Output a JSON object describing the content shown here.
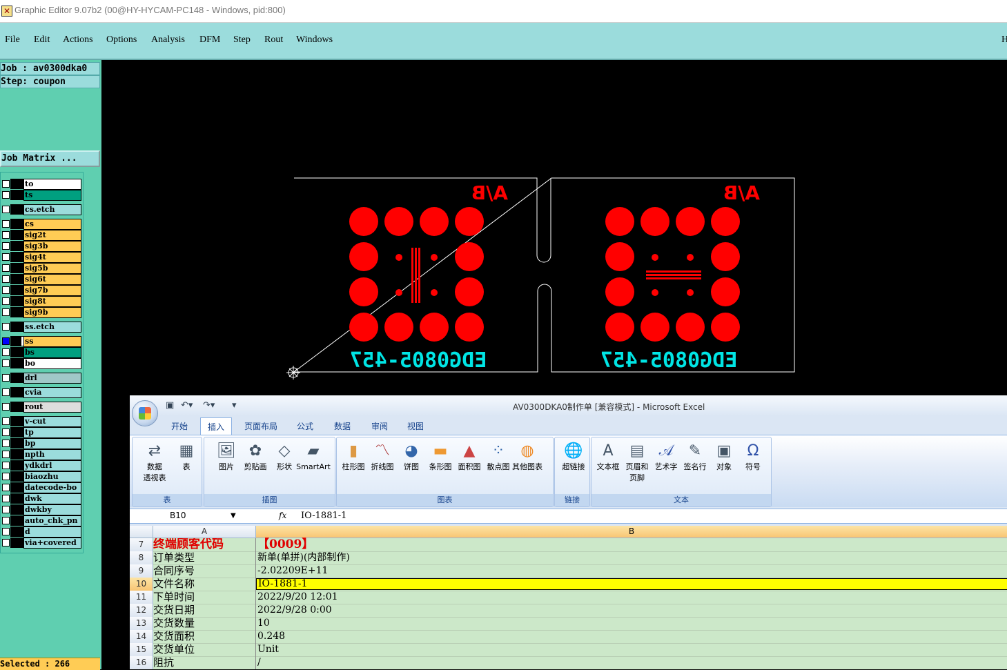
{
  "window": {
    "title": "Graphic Editor 9.07b2 (00@HY-HYCAM-PC148 - Windows, pid:800)"
  },
  "menu": [
    "File",
    "Edit",
    "Actions",
    "Options",
    "Analysis",
    "DFM",
    "Step",
    "Rout",
    "Windows"
  ],
  "menu_right": "H",
  "job": {
    "job_label": "Job : av0300dka0",
    "step_label": "Step: coupon",
    "matrix_button": "Job Matrix ..."
  },
  "layers": [
    {
      "name": "to",
      "color": "#ffffff"
    },
    {
      "name": "ts",
      "color": "#00a080"
    },
    {
      "name": "cs.etch",
      "color": "#9bdcdc"
    },
    {
      "name": "cs",
      "color": "#ffcc55"
    },
    {
      "name": "sig2t",
      "color": "#ffcc55"
    },
    {
      "name": "sig3b",
      "color": "#ffcc55"
    },
    {
      "name": "sig4t",
      "color": "#ffcc55"
    },
    {
      "name": "sig5b",
      "color": "#ffcc55"
    },
    {
      "name": "sig6t",
      "color": "#ffcc55"
    },
    {
      "name": "sig7b",
      "color": "#ffcc55"
    },
    {
      "name": "sig8t",
      "color": "#ffcc55"
    },
    {
      "name": "sig9b",
      "color": "#ffcc55"
    },
    {
      "name": "ss.etch",
      "color": "#9bdcdc"
    },
    {
      "name": "ss",
      "color": "#ffcc55",
      "active": true
    },
    {
      "name": "bs",
      "color": "#00a080"
    },
    {
      "name": "bo",
      "color": "#ffffff"
    },
    {
      "name": "drl",
      "color": "#a0c8c8"
    },
    {
      "name": "cvia",
      "color": "#9bdcdc"
    },
    {
      "name": "rout",
      "color": "#dddddd"
    },
    {
      "name": "v-cut",
      "color": "#9bdcdc"
    },
    {
      "name": "tp",
      "color": "#9bdcdc"
    },
    {
      "name": "bp",
      "color": "#9bdcdc"
    },
    {
      "name": "npth",
      "color": "#9bdcdc"
    },
    {
      "name": "ydkdrl",
      "color": "#9bdcdc"
    },
    {
      "name": "biaozhu",
      "color": "#9bdcdc"
    },
    {
      "name": "datecode-bo",
      "color": "#9bdcdc"
    },
    {
      "name": "dwk",
      "color": "#9bdcdc"
    },
    {
      "name": "dwkby",
      "color": "#9bdcdc"
    },
    {
      "name": "auto_chk_pn",
      "color": "#9bdcdc"
    },
    {
      "name": "d",
      "color": "#9bdcdc"
    },
    {
      "name": "via+covered",
      "color": "#9bdcdc"
    }
  ],
  "status": {
    "selected": "Selected : 266"
  },
  "canvas": {
    "left_label": "A/B",
    "right_label": "A/B",
    "left_code": "EDG0805-457",
    "right_code": "EDG0805-457",
    "pad_color": "#ff0000",
    "text_color": "#00e5e5"
  },
  "excel": {
    "title": "AV0300DKA0制作单  [兼容模式] - Microsoft Excel",
    "tabs": [
      "开始",
      "插入",
      "页面布局",
      "公式",
      "数据",
      "审阅",
      "视图"
    ],
    "active_tab": "插入",
    "ribbon_groups": [
      {
        "label": "表",
        "buttons": [
          {
            "label": "数据\n透视表",
            "icon": "pivot-table-icon"
          },
          {
            "label": "表",
            "icon": "table-icon"
          }
        ]
      },
      {
        "label": "插图",
        "buttons": [
          {
            "label": "图片",
            "icon": "picture-icon"
          },
          {
            "label": "剪贴画",
            "icon": "clipart-icon"
          },
          {
            "label": "形状",
            "icon": "shapes-icon"
          },
          {
            "label": "SmartArt",
            "icon": "smartart-icon"
          }
        ]
      },
      {
        "label": "图表",
        "buttons": [
          {
            "label": "柱形图",
            "icon": "column-chart-icon"
          },
          {
            "label": "折线图",
            "icon": "line-chart-icon"
          },
          {
            "label": "饼图",
            "icon": "pie-chart-icon"
          },
          {
            "label": "条形图",
            "icon": "bar-chart-icon"
          },
          {
            "label": "面积图",
            "icon": "area-chart-icon"
          },
          {
            "label": "散点图",
            "icon": "scatter-chart-icon"
          },
          {
            "label": "其他图表",
            "icon": "other-charts-icon"
          }
        ]
      },
      {
        "label": "链接",
        "buttons": [
          {
            "label": "超链接",
            "icon": "hyperlink-icon"
          }
        ]
      },
      {
        "label": "文本",
        "buttons": [
          {
            "label": "文本框",
            "icon": "textbox-icon"
          },
          {
            "label": "页眉和\n页脚",
            "icon": "header-footer-icon"
          },
          {
            "label": "艺术字",
            "icon": "wordart-icon"
          },
          {
            "label": "签名行",
            "icon": "signature-icon"
          },
          {
            "label": "对象",
            "icon": "object-icon"
          },
          {
            "label": "符号",
            "icon": "symbol-icon"
          }
        ]
      }
    ],
    "name_box": "B10",
    "fx": "fx",
    "formula": "IO-1881-1",
    "columns": [
      "A",
      "B"
    ],
    "rows": [
      {
        "n": "7",
        "a": "终端顾客代码",
        "b": "【0009】",
        "red": true
      },
      {
        "n": "8",
        "a": "订单类型",
        "b": "新单(单拼)(内部制作)"
      },
      {
        "n": "9",
        "a": "合同序号",
        "b": "-2.02209E+11"
      },
      {
        "n": "10",
        "a": "文件名称",
        "b": "IO-1881-1",
        "selected": true
      },
      {
        "n": "11",
        "a": "下单时间",
        "b": "2022/9/20  12:01"
      },
      {
        "n": "12",
        "a": "交货日期",
        "b": "2022/9/28  0:00"
      },
      {
        "n": "13",
        "a": "交货数量",
        "b": "10"
      },
      {
        "n": "14",
        "a": "交货面积",
        "b": "0.248"
      },
      {
        "n": "15",
        "a": "交货单位",
        "b": "Unit"
      },
      {
        "n": "16",
        "a": "阻抗",
        "b": "/"
      }
    ]
  }
}
